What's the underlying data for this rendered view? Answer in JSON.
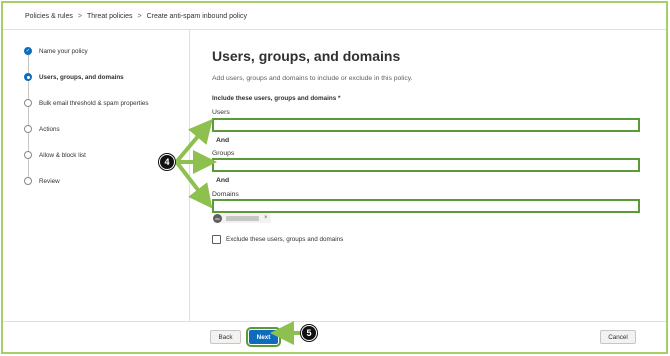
{
  "breadcrumb": {
    "items": [
      "Policies & rules",
      "Threat policies",
      "Create anti-spam inbound policy"
    ],
    "separator": ">"
  },
  "wizard": {
    "steps": [
      {
        "label": "Name your policy",
        "state": "done"
      },
      {
        "label": "Users, groups, and domains",
        "state": "current"
      },
      {
        "label": "Bulk email threshold & spam properties",
        "state": "pending"
      },
      {
        "label": "Actions",
        "state": "pending"
      },
      {
        "label": "Allow & block list",
        "state": "pending"
      },
      {
        "label": "Review",
        "state": "pending"
      }
    ]
  },
  "main": {
    "title": "Users, groups, and domains",
    "subtitle": "Add users, groups and domains to include or exclude in this policy.",
    "include_label": "Include these users, groups and domains *",
    "users_label": "Users",
    "groups_label": "Groups",
    "domains_label": "Domains",
    "and_label": "And",
    "domain_chip": {
      "avatar": "do",
      "remove": "×"
    },
    "exclude_label": "Exclude these users, groups and domains"
  },
  "footer": {
    "back_label": "Back",
    "next_label": "Next",
    "cancel_label": "Cancel"
  },
  "annotations": {
    "callout_fields": "4",
    "callout_next": "5",
    "color": "#8dc04e"
  },
  "colors": {
    "accent": "#0f6cbd",
    "highlight": "#5a9a38",
    "frame": "#a6ce6a"
  }
}
